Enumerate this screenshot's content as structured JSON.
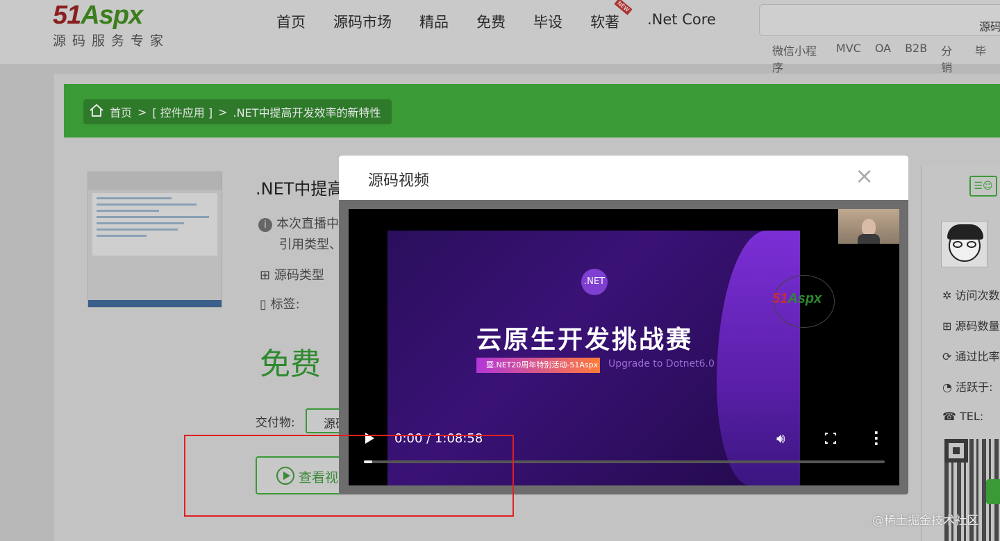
{
  "site": {
    "logo_text_a": "51",
    "logo_text_b": "Aspx",
    "logo_tagline": "源码服务专家"
  },
  "nav": {
    "items": [
      "首页",
      "源码市场",
      "精品",
      "免费",
      "毕设",
      "软著",
      ".Net Core"
    ]
  },
  "search": {
    "type_label": "源码",
    "hot_keywords": [
      "微信小程序",
      "MVC",
      "OA",
      "B2B",
      "分销",
      "毕"
    ]
  },
  "breadcrumb": {
    "home": "首页",
    "sep": ">",
    "category": "[ 控件应用 ]",
    "current": ".NET中提高开发效率的新特性"
  },
  "product": {
    "title": ".NET中提高",
    "desc_line1": "本次直播中",
    "desc_line2": "引用类型、",
    "type_label": "源码类型",
    "tags_label": "标签:",
    "price": "免费",
    "deliver_label": "交付物:",
    "deliver_value": "源码",
    "watch_label": "查看视"
  },
  "sidebar": {
    "stats": [
      "访问次数",
      "源码数量",
      "通过比率",
      "活跃于:",
      "TEL:"
    ]
  },
  "modal": {
    "title": "源码视频",
    "close": "×"
  },
  "video": {
    "badge": ".NET",
    "slide_title": "云原生开发挑战赛",
    "slide_tag": "暨.NET20周年特别活动-51Aspx",
    "slide_sub": "Upgrade to Dotnet6.0",
    "logo_a": "51",
    "logo_b": "Aspx",
    "time": "0:00 / 1:08:58",
    "progress": 0.01
  },
  "watermark": "@稀土掘金技术社区",
  "colors": {
    "brand_green": "#3a9a36",
    "highlight_red": "#e02020"
  }
}
